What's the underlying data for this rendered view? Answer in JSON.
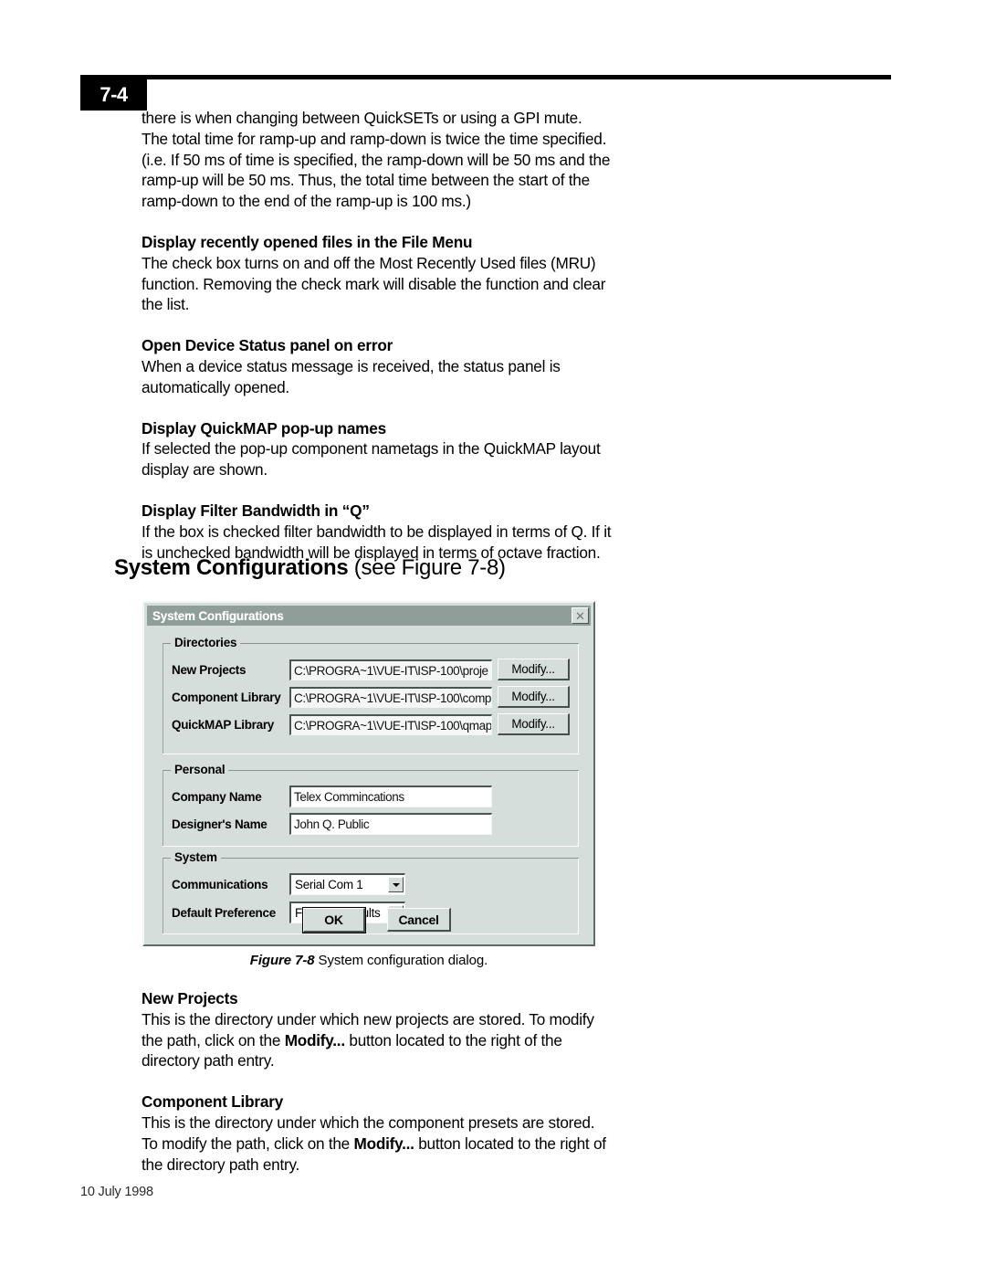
{
  "header": {
    "page_number": "7-4"
  },
  "body": {
    "paragraph_1": [
      "there is when changing between QuickSETs or using a GPI mute.",
      "The total time for ramp-up and ramp-down is twice the time specified.",
      "(i.e. If 50 ms of time is specified, the ramp-down will be 50 ms and the",
      "ramp-up will be 50 ms. Thus, the total time between the start of the",
      "ramp-down to the end of the ramp-up is 100 ms.)"
    ],
    "sections": [
      {
        "heading": "Display recently opened files in the File Menu",
        "lines": [
          "The check box turns on and off the Most Recently Used files (MRU)",
          "function.  Removing the check mark will disable the function and clear",
          "the list."
        ]
      },
      {
        "heading": "Open Device Status panel on error",
        "lines": [
          "When a device status message is received, the status panel is",
          "automatically opened."
        ]
      },
      {
        "heading": "Display QuickMAP pop-up names",
        "lines": [
          "If selected the pop-up component nametags in the QuickMAP layout",
          "display are shown."
        ]
      },
      {
        "heading": "Display Filter Bandwidth in “Q”",
        "lines": [
          "If the box is checked filter bandwidth to be displayed in terms of Q. If it",
          "is unchecked bandwidth will be displayed in terms of octave fraction."
        ]
      }
    ],
    "section_title": {
      "bold": "System Configurations",
      "normal": " (see Figure 7-8)"
    }
  },
  "dialog": {
    "title": "System Configurations",
    "close_label": "✕",
    "groups": {
      "directories": {
        "legend": "Directories",
        "rows": [
          {
            "label": "New Projects",
            "value": "C:\\PROGRA~1\\VUE-IT\\ISP-100\\proje",
            "button": "Modify..."
          },
          {
            "label": "Component Library",
            "value": "C:\\PROGRA~1\\VUE-IT\\ISP-100\\comp",
            "button": "Modify..."
          },
          {
            "label": "QuickMAP Library",
            "value": "C:\\PROGRA~1\\VUE-IT\\ISP-100\\qmap",
            "button": "Modify..."
          }
        ]
      },
      "personal": {
        "legend": "Personal",
        "rows": [
          {
            "label": "Company Name",
            "value": "Telex Commincations"
          },
          {
            "label": "Designer's Name",
            "value": "John Q. Public"
          }
        ]
      },
      "system": {
        "legend": "System",
        "rows": [
          {
            "label": "Communications",
            "value": "Serial Com 1"
          },
          {
            "label": "Default Preference",
            "value": "Factory Defaults"
          }
        ]
      }
    },
    "buttons": {
      "ok": "OK",
      "cancel": "Cancel"
    }
  },
  "figure": {
    "label": "Figure 7-8",
    "caption": " System configuration dialog."
  },
  "after_figure": [
    {
      "heading": "New Projects",
      "lines": [
        {
          "parts": [
            {
              "t": "This is the directory under which new projects are stored. To modify",
              "b": false
            }
          ]
        },
        {
          "parts": [
            {
              "t": "the path, click on the ",
              "b": false
            },
            {
              "t": "Modify...",
              "b": true
            },
            {
              "t": " button located to the right of the",
              "b": false
            }
          ]
        },
        {
          "parts": [
            {
              "t": "directory path entry.",
              "b": false
            }
          ]
        }
      ]
    },
    {
      "heading": "Component Library",
      "lines": [
        {
          "parts": [
            {
              "t": "This is the directory under which the component presets are stored.",
              "b": false
            }
          ]
        },
        {
          "parts": [
            {
              "t": "To modify the path, click on the ",
              "b": false
            },
            {
              "t": "Modify...",
              "b": true
            },
            {
              "t": " button located to the right of",
              "b": false
            }
          ]
        },
        {
          "parts": [
            {
              "t": "the directory path entry.",
              "b": false
            }
          ]
        }
      ]
    }
  ],
  "footer": {
    "date": "10 July 1998"
  }
}
